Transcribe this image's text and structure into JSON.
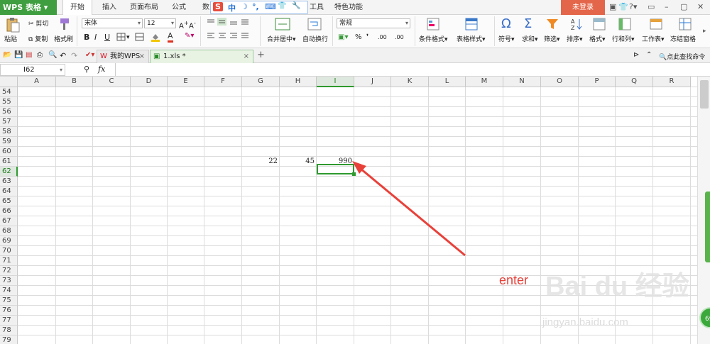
{
  "app": {
    "title": "WPS 表格"
  },
  "menu_tabs": [
    "开始",
    "插入",
    "页面布局",
    "公式",
    "数",
    "工具",
    "特色功能"
  ],
  "ime_bar": {
    "logo": "S",
    "mode": "中",
    "moon": "☽",
    "punct": "°,",
    "keyboard": "⌨",
    "shirt": "👕",
    "wrench": "🔧"
  },
  "login_label": "未登录",
  "window_controls": [
    "▣",
    "👕",
    "?▾",
    "▭",
    "–",
    "▢",
    "✕"
  ],
  "ribbon": {
    "paste": "粘贴",
    "cut": "剪切",
    "copy": "复制",
    "format_painter": "格式刷",
    "font_name": "宋体",
    "font_size": "12",
    "bold": "B",
    "italic": "I",
    "underline": "U",
    "merge_center": "合并居中",
    "wrap": "自动换行",
    "number_format": "常规",
    "percent": "%",
    "comma": "❜",
    "cond_format": "条件格式",
    "table_style": "表格样式",
    "symbol": "符号",
    "sum": "求和",
    "filter": "筛选",
    "sort": "排序",
    "format": "格式",
    "row_col": "行和列",
    "sheet": "工作表",
    "freeze": "冻结窗格"
  },
  "doc_tabs": [
    {
      "label": "我的WPS",
      "close": "×"
    },
    {
      "label": "1.xls *",
      "close": "×"
    }
  ],
  "new_tab": "+",
  "search_hint": "点此查找命令",
  "formula_bar": {
    "cell_ref": "I62",
    "fx": "fx",
    "formula": ""
  },
  "columns": [
    "A",
    "B",
    "C",
    "D",
    "E",
    "F",
    "G",
    "H",
    "I",
    "J",
    "K",
    "L",
    "M",
    "N",
    "O",
    "P",
    "Q",
    "R"
  ],
  "rows": [
    "54",
    "55",
    "56",
    "57",
    "58",
    "59",
    "60",
    "61",
    "62",
    "63",
    "64",
    "65",
    "66",
    "67",
    "68",
    "69",
    "70",
    "71",
    "72",
    "73",
    "74",
    "75",
    "76",
    "77",
    "78",
    "79"
  ],
  "cells": [
    {
      "ref": "G61",
      "value": "22"
    },
    {
      "ref": "H61",
      "value": "45"
    },
    {
      "ref": "I61",
      "value": "990"
    }
  ],
  "annotation": {
    "text": "enter",
    "color": "#e8413a"
  },
  "watermark": {
    "text": "Bai du 经验",
    "url": "jingyan.baidu.com"
  },
  "badge": "69",
  "colors": {
    "accent": "#2f9a2f",
    "brand": "#3f9e3f",
    "login": "#e4664a"
  }
}
